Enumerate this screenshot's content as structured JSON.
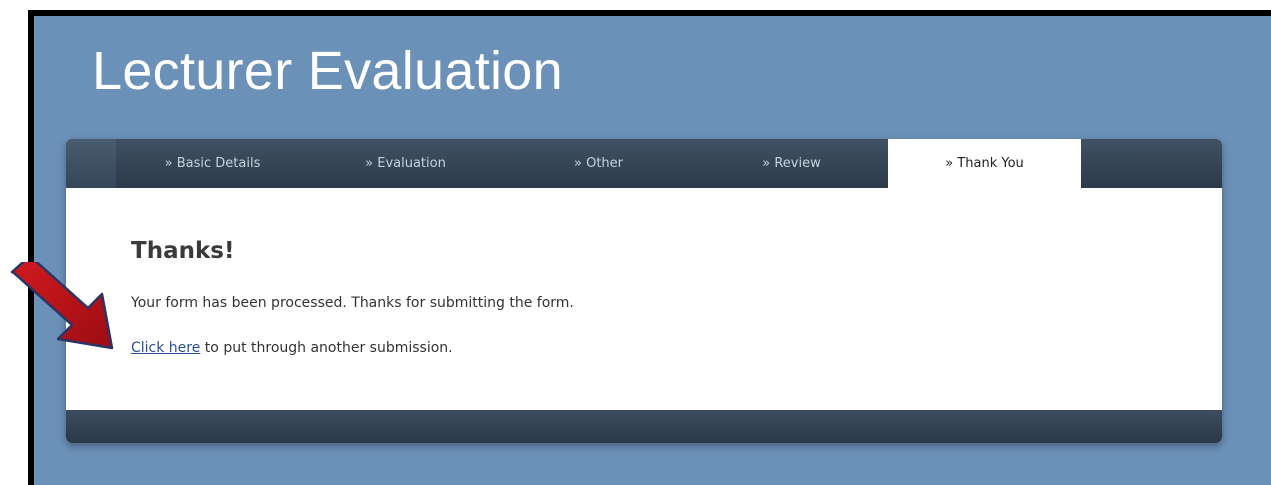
{
  "header": {
    "title": "Lecturer Evaluation"
  },
  "tabs": [
    {
      "label": "» Basic Details",
      "active": false
    },
    {
      "label": "» Evaluation",
      "active": false
    },
    {
      "label": "» Other",
      "active": false
    },
    {
      "label": "» Review",
      "active": false
    },
    {
      "label": "» Thank You",
      "active": true
    }
  ],
  "content": {
    "heading": "Thanks!",
    "message": "Your form has been processed. Thanks for submitting the form.",
    "link_text": "Click here",
    "link_suffix": " to put through another submission."
  },
  "colors": {
    "page_background": "#6b91b8",
    "tab_bar": "#2c3a49",
    "link": "#2b4f9a",
    "annotation_arrow": "#c0141a"
  },
  "annotation": {
    "icon": "red-arrow-icon"
  }
}
